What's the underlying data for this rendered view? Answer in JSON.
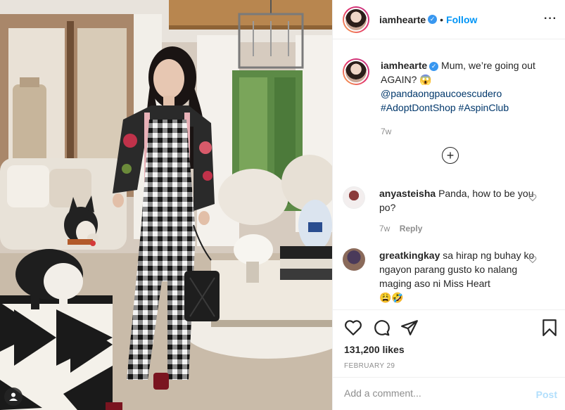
{
  "colors": {
    "link": "#00376b",
    "follow": "#0095f6",
    "verified": "#3897f0",
    "muted": "#8e8e8e"
  },
  "header": {
    "username": "iamhearte",
    "separator": "•",
    "follow_label": "Follow",
    "more_icon": "more-options-icon"
  },
  "caption": {
    "username": "iamhearte",
    "text": "Mum, we’re going out AGAIN?",
    "emoji": "😱",
    "mention": "@pandaongpaucoescudero",
    "hashtags": "#AdoptDontShop #AspinClub",
    "time": "7w"
  },
  "load_more_icon": "plus-circle-icon",
  "comments": [
    {
      "username": "anyasteisha",
      "text": "Panda, how to be you po?",
      "time": "7w",
      "reply_label": "Reply"
    },
    {
      "username": "greatkingkay",
      "text": "sa hirap ng buhay ko ngayon parang gusto ko nalang maging aso ni Miss Heart",
      "emoji": "😩🤣"
    }
  ],
  "actions": {
    "like_icon": "heart-icon",
    "comment_icon": "comment-icon",
    "share_icon": "share-icon",
    "save_icon": "bookmark-icon"
  },
  "likes": "131,200 likes",
  "date": "FEBRUARY 29",
  "add_comment": {
    "placeholder": "Add a comment...",
    "post_label": "Post"
  }
}
